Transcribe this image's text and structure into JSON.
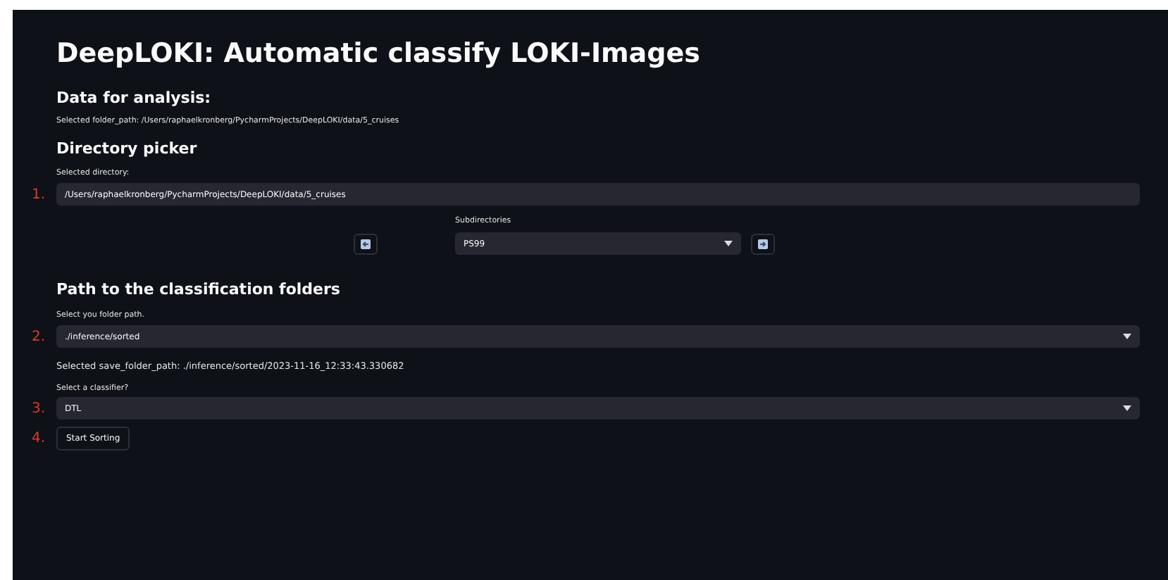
{
  "title": "DeepLOKI: Automatic classify LOKI-Images",
  "data_section": {
    "heading": "Data for analysis:",
    "selected_path": "Selected folder_path: /Users/raphaelkronberg/PycharmProjects/DeepLOKI/data/5_cruises"
  },
  "directory_picker": {
    "heading": "Directory picker",
    "label": "Selected directory:",
    "marker": "1.",
    "value": "/Users/raphaelkronberg/PycharmProjects/DeepLOKI/data/5_cruises",
    "subdirectories_label": "Subdirectories",
    "subdirectory": "PS99"
  },
  "classification": {
    "heading": "Path to the classification folders",
    "folder_label": "Select you folder path.",
    "folder_marker": "2.",
    "folder_value": "./inference/sorted",
    "save_path": "Selected save_folder_path: ./inference/sorted/2023-11-16_12:33:43.330682",
    "classifier_label": "Select a classifier?",
    "classifier_marker": "3.",
    "classifier_value": "DTL",
    "button_marker": "4.",
    "button": "Start Sorting"
  }
}
